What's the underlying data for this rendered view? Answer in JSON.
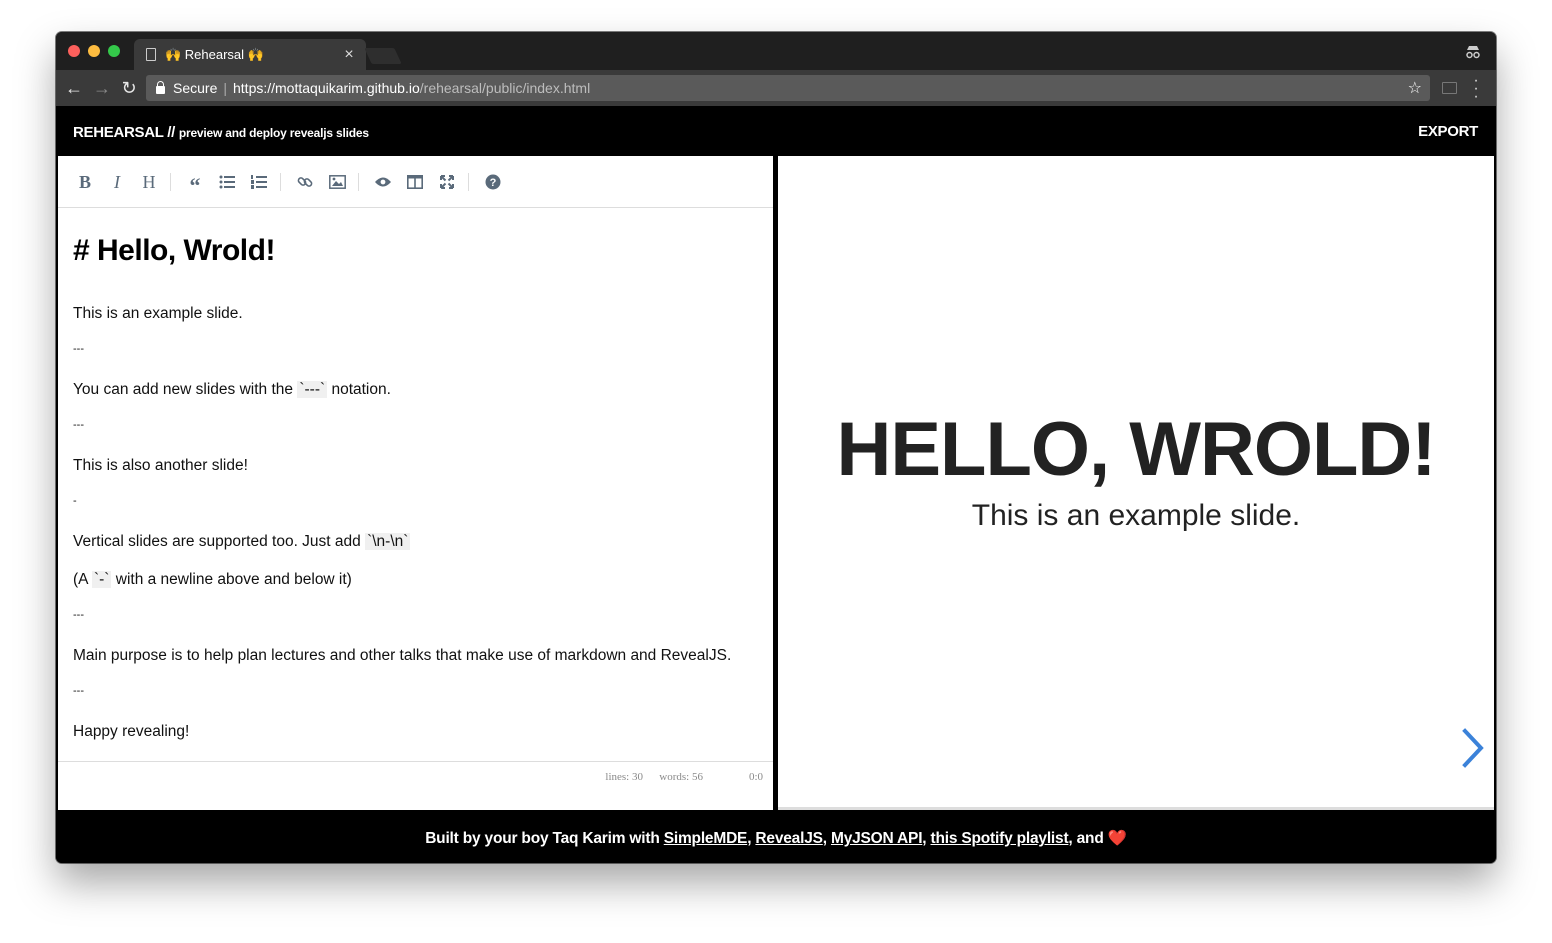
{
  "browser": {
    "tab_title": "🙌 Rehearsal 🙌",
    "tab_close": "×",
    "secure_label": "Secure",
    "url_host": "https://mottaquikarim.github.io",
    "url_path": "/rehearsal/public/index.html"
  },
  "header": {
    "brand": "REHEARSAL //",
    "tagline": "preview and deploy revealjs slides",
    "export_label": "EXPORT"
  },
  "editor": {
    "toolbar_icons": [
      "bold-icon",
      "italic-icon",
      "heading-icon",
      "quote-icon",
      "unordered-list-icon",
      "ordered-list-icon",
      "link-icon",
      "image-icon",
      "preview-icon",
      "side-by-side-icon",
      "fullscreen-icon",
      "help-icon"
    ],
    "heading": "# Hello, Wrold!",
    "lines": {
      "l1": "This is an example slide.",
      "l2": "---",
      "l3a": "You can add new slides with the ",
      "l3code": "`---`",
      "l3b": " notation.",
      "l4": "---",
      "l5": "This is also another slide!",
      "l6": "-",
      "l7a": "Vertical slides are supported too. Just add ",
      "l7code": "`\\n-\\n`",
      "l8a": "(A ",
      "l8code": "`-`",
      "l8b": " with a newline above and below it)",
      "l9": "---",
      "l10": "Main purpose is to help plan lectures and other talks that make use of markdown and RevealJS.",
      "l11": "---",
      "l12": "Happy revealing!"
    },
    "status": {
      "lines": "lines: 30",
      "words": "words: 56",
      "cursor": "0:0"
    }
  },
  "preview": {
    "title": "HELLO, WROLD!",
    "text": "This is an example slide."
  },
  "footer": {
    "prefix": "Built by your boy Taq Karim with ",
    "link1": "SimpleMDE",
    "comma1": ", ",
    "link2": "RevealJS",
    "comma2": ", ",
    "link3": "MyJSON API",
    "comma3": ", ",
    "link4": "this Spotify playlist",
    "suffix": ", and ",
    "heart": "❤️"
  },
  "colors": {
    "accent_arrow": "#3b82d9",
    "header_bg": "#000000",
    "toolbar_icon": "#5a6a7a"
  }
}
